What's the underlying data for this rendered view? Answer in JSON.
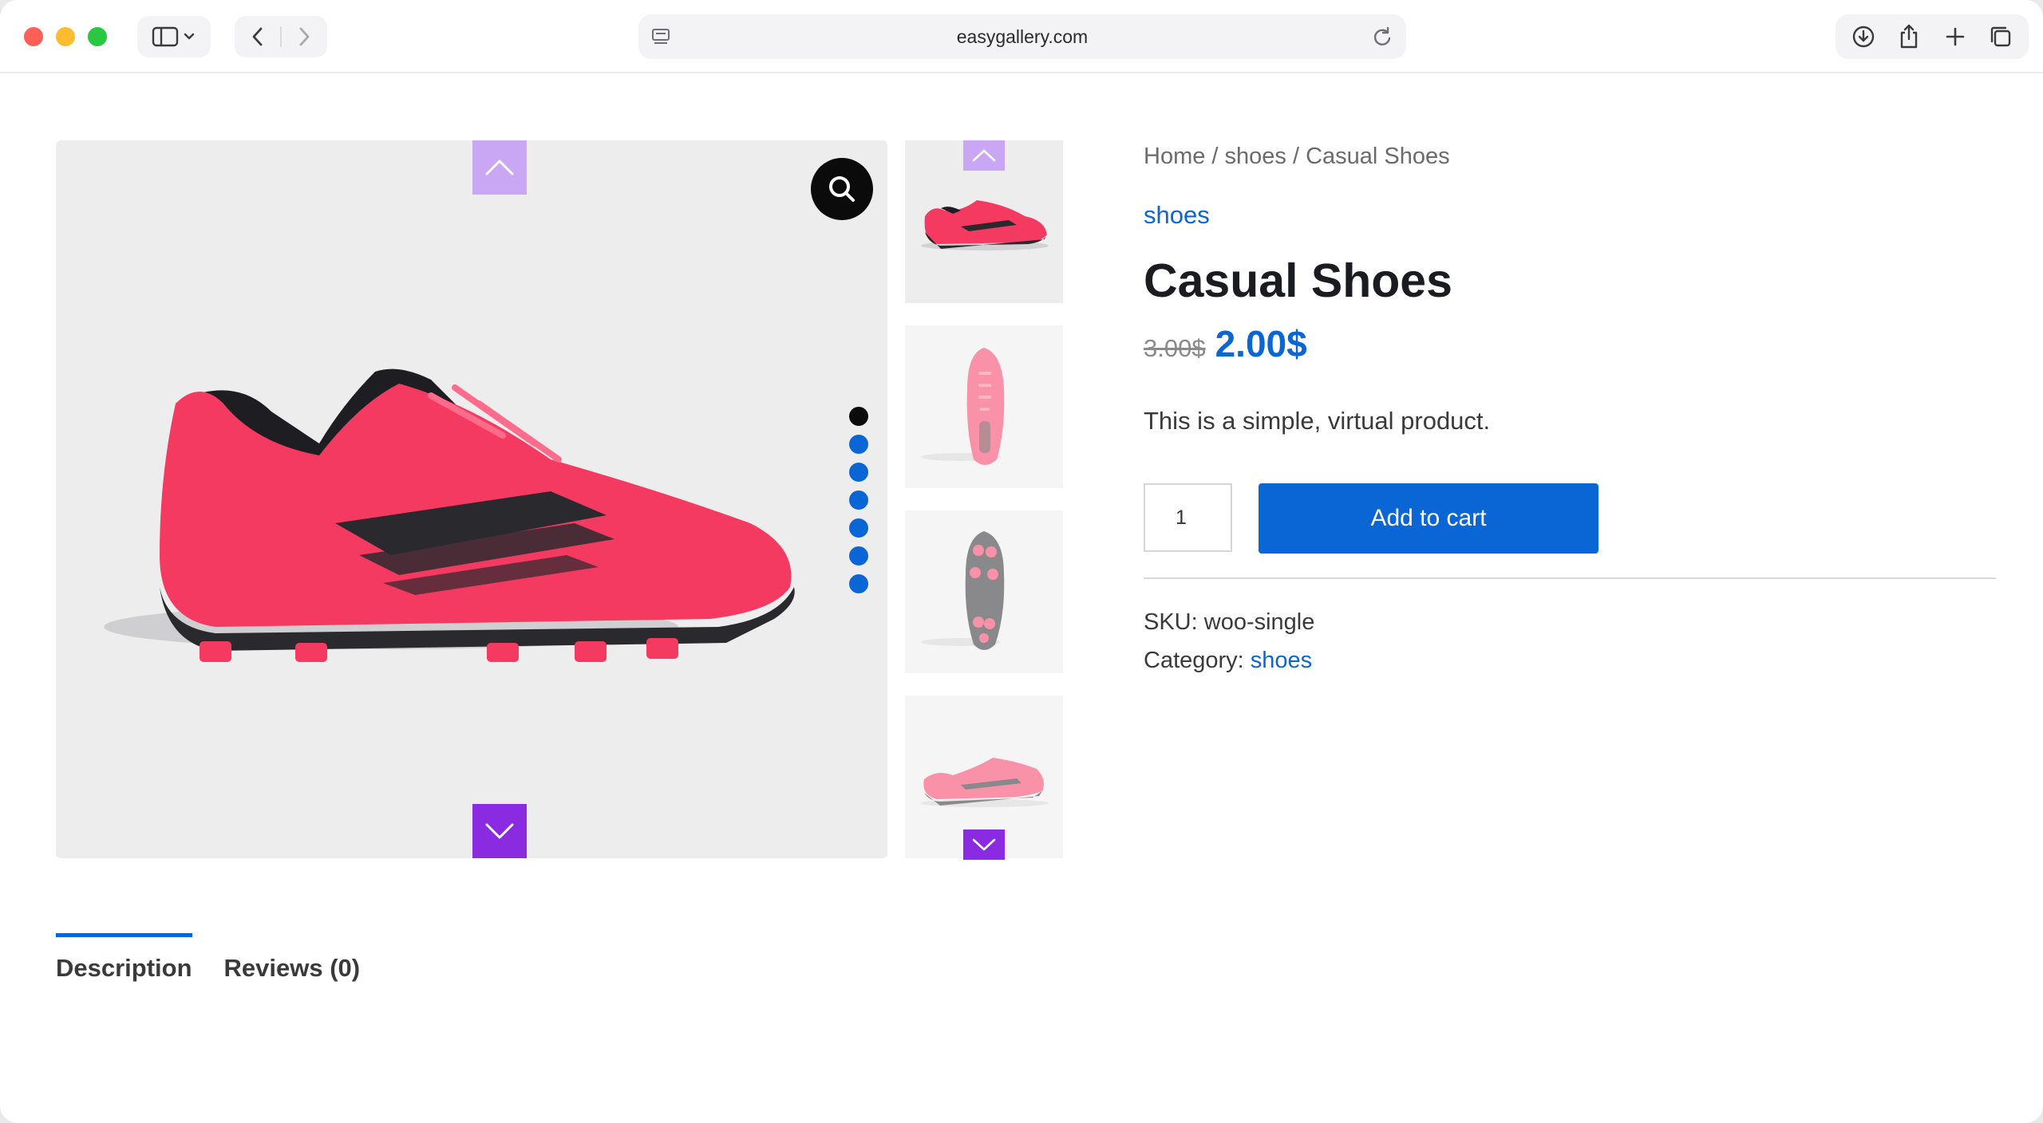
{
  "browser": {
    "url": "easygallery.com"
  },
  "breadcrumb": {
    "items": [
      "Home",
      "shoes",
      "Casual Shoes"
    ],
    "separator": " / "
  },
  "product": {
    "category_top": "shoes",
    "title": "Casual Shoes",
    "price_old": "3.00$",
    "price_new": "2.00$",
    "short_description": "This is a simple, virtual product.",
    "quantity": "1",
    "add_to_cart_label": "Add to cart",
    "sku_label": "SKU:",
    "sku_value": "woo-single",
    "category_label": "Category:",
    "category_value": "shoes"
  },
  "gallery": {
    "slide_count": 7,
    "active_slide": 1,
    "thumbnails": [
      "shoe-side-view",
      "shoe-top-view",
      "shoe-sole-view",
      "shoe-pair-view"
    ]
  },
  "tabs": [
    {
      "label": "Description",
      "active": true
    },
    {
      "label": "Reviews (0)",
      "active": false
    }
  ],
  "colors": {
    "accent_blue": "#0a66d4",
    "arrow_purple": "#8a2be2",
    "arrow_purple_light": "#c9a7f4",
    "shoe_pink": "#f53a62"
  }
}
